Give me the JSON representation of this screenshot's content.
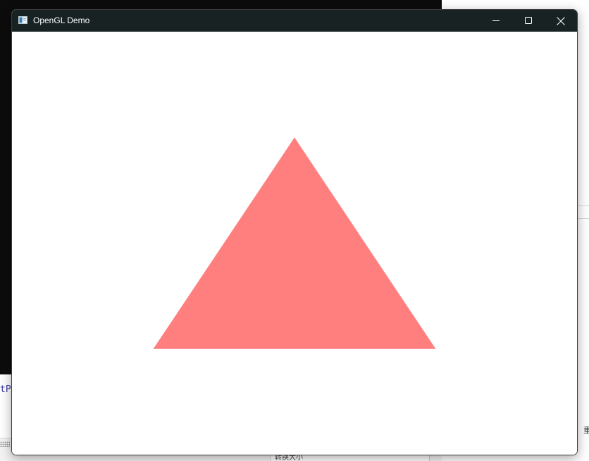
{
  "background": {
    "editor_code_fragment": "tP",
    "right_app_text": "重",
    "status_field_text": "转换大小"
  },
  "window": {
    "title": "OpenGL Demo",
    "icon": "app-window-icon",
    "controls": {
      "minimize_icon": "minimize-icon",
      "maximize_icon": "maximize-icon",
      "close_icon": "close-icon"
    }
  },
  "scene": {
    "clear_color": "#ffffff",
    "shape": "triangle",
    "fill_color": "#ff7f7f",
    "vertices_ndc": [
      [
        -0.5,
        -0.5
      ],
      [
        0.5,
        -0.5
      ],
      [
        0.0,
        0.5
      ]
    ]
  }
}
